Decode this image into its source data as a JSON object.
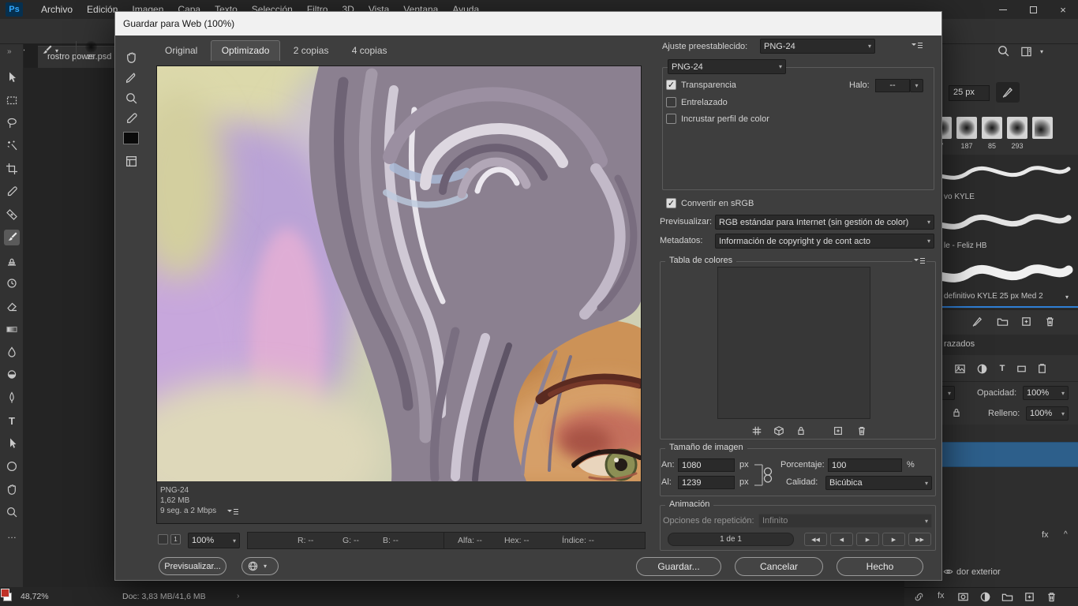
{
  "colors": {
    "accent_blue": "#31a8ff",
    "selected_layer": "#2d5f8b",
    "dialog_title_bar": "#f1f1f1",
    "panel_bg": "#323232"
  },
  "icons": {
    "chevron_down": "▾",
    "chevron_up": "^",
    "chevron_right": "›",
    "double_chevron": "»",
    "check": "✓",
    "close": "×",
    "ellipsis": "…",
    "type_tool": "T",
    "fx": "fx",
    "rewind": "◀◀",
    "prev_frame": "◀",
    "play": "▶",
    "next_frame": "▶",
    "fast_forward": "▶▶"
  },
  "menu_bar": {
    "logo": "Ps",
    "items": [
      "Archivo",
      "Edición",
      "Imagen",
      "Capa",
      "Texto",
      "Selección",
      "Filtro",
      "3D",
      "Vista",
      "Ventana",
      "Ayuda"
    ]
  },
  "options_bar": {
    "brush_size": "25"
  },
  "document_tab": {
    "title": "rostro power.psd"
  },
  "dialog": {
    "title": "Guardar para Web (100%)",
    "tabs": [
      "Original",
      "Optimizado",
      "2 copias",
      "4 copias"
    ],
    "preview": {
      "format": "PNG-24",
      "file_size": "1,62 MB",
      "download_time": "9 seg. a 2 Mbps"
    },
    "slice_badge": "1",
    "zoom": "100%",
    "readouts": {
      "r": "R: --",
      "g": "G: --",
      "b": "B: --",
      "alpha": "Alfa: --",
      "hex": "Hex: --",
      "index": "Índice: --"
    },
    "preview_button": "Previsualizar...",
    "settings": {
      "preset_label": "Ajuste preestablecido:",
      "preset_value": "PNG-24",
      "format_value": "PNG-24",
      "transparency": "Transparencia",
      "halo_label": "Halo:",
      "halo_value": "--",
      "interlaced": "Entrelazado",
      "embed_profile": "Incrustar perfil de color",
      "convert_srgb": "Convertir en sRGB",
      "preview_label": "Previsualizar:",
      "preview_value": "RGB estándar para Internet (sin gestión de color)",
      "metadata_label": "Metadatos:",
      "metadata_value": "Información de copyright y de cont acto"
    },
    "color_table": {
      "title": "Tabla de colores"
    },
    "image_size": {
      "title": "Tamaño de imagen",
      "width_label": "An:",
      "width_value": "1080",
      "width_unit": "px",
      "height_label": "Al:",
      "height_value": "1239",
      "height_unit": "px",
      "percent_label": "Porcentaje:",
      "percent_value": "100",
      "percent_unit": "%",
      "quality_label": "Calidad:",
      "quality_value": "Bicúbica"
    },
    "animation": {
      "title": "Animación",
      "loop_label": "Opciones de repetición:",
      "loop_value": "Infinito",
      "frame_status": "1 de 1"
    },
    "buttons": {
      "save": "Guardar...",
      "cancel": "Cancelar",
      "done": "Hecho"
    }
  },
  "panels": {
    "brushes": {
      "size_field": "25 px",
      "tip_sizes": [
        "7",
        "187",
        "85",
        "293"
      ],
      "preset_names": [
        "vo KYLE",
        "le - Feliz HB",
        "definitivo KYLE 25 px Med 2"
      ]
    },
    "paths_tab": "razados",
    "layers": {
      "opacity_label": "Opacidad:",
      "opacity_value": "100%",
      "fill_label": "Relleno:",
      "fill_value": "100%",
      "fx_label": "fx",
      "effect_row": "dor exterior"
    }
  },
  "status_bar": {
    "zoom": "48,72%",
    "doc_info": "Doc: 3,83 MB/41,6 MB"
  }
}
